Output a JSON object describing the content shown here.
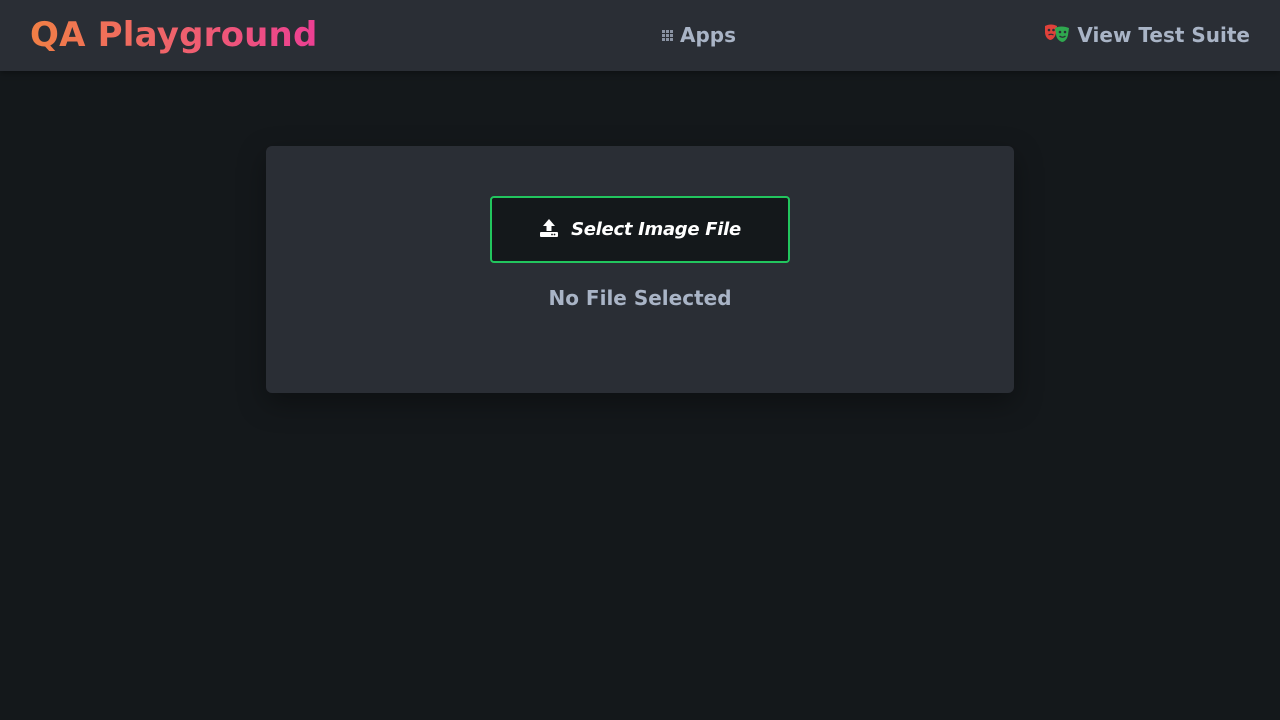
{
  "navbar": {
    "brand": "QA Playground",
    "apps_icon": "grid-icon",
    "apps_label": "Apps",
    "suite_icon": "theater-masks-icon",
    "suite_label": "View Test Suite"
  },
  "upload": {
    "button_icon": "upload-icon",
    "button_label": "Select Image File",
    "status_text": "No File Selected"
  },
  "colors": {
    "background": "#14181b",
    "surface": "#2a2e35",
    "accent_green": "#22c55e",
    "brand_gradient_start": "#f07f45",
    "brand_gradient_end": "#ec3f93",
    "muted_text": "#a9b4c6"
  }
}
